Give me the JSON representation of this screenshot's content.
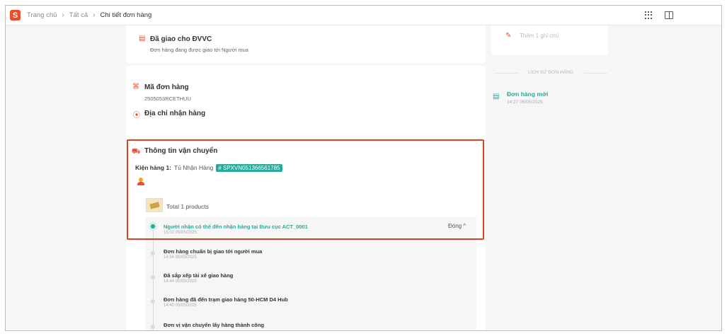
{
  "header": {
    "logo_text": "S",
    "breadcrumb": [
      "Trang chủ",
      "Tất cả",
      "Chi tiết đơn hàng"
    ]
  },
  "delivered": {
    "title": "Đã giao cho ĐVVC",
    "subtitle": "Đơn hàng đang được giao tới Người mua"
  },
  "note": {
    "placeholder": "Thêm 1 ghi chú"
  },
  "order": {
    "id_label": "Mã đơn hàng",
    "id_value": "2505053RCETHUU",
    "address_label": "Địa chỉ nhận hàng"
  },
  "shipping": {
    "title": "Thông tin vận chuyển",
    "package_label": "Kiện hàng 1:",
    "package_method": "Tủ Nhận Hàng",
    "tracking_code": "# SPXVN051366561785",
    "products_text": "Total 1 products",
    "collapse_label": "Đóng ^"
  },
  "timeline": [
    {
      "title": "Người nhận có thể đến nhận hàng tại Bưu cục ACT_0001",
      "time": "15:02 05/05/2025",
      "active": true
    },
    {
      "title": "Đơn hàng chuẩn bị giao tới người mua",
      "time": "14:54 05/05/2025"
    },
    {
      "title": "Đã sắp xếp tài xế giao hàng",
      "time": "14:44 05/05/2025"
    },
    {
      "title": "Đơn hàng đã đến trạm giao hàng 50-HCM D4 Hub",
      "time": "14:40 05/05/2025"
    },
    {
      "title": "Đơn vị vận chuyển lấy hàng thành công",
      "time": ""
    }
  ],
  "history": {
    "heading": "LỊCH SỬ ĐƠN HÀNG",
    "items": [
      {
        "title": "Đơn hàng mới",
        "time": "14:27 05/05/2025"
      }
    ]
  },
  "colors": {
    "brand": "#ee4d2d",
    "accent": "#26aa99",
    "highlight_border": "#d6451f"
  }
}
